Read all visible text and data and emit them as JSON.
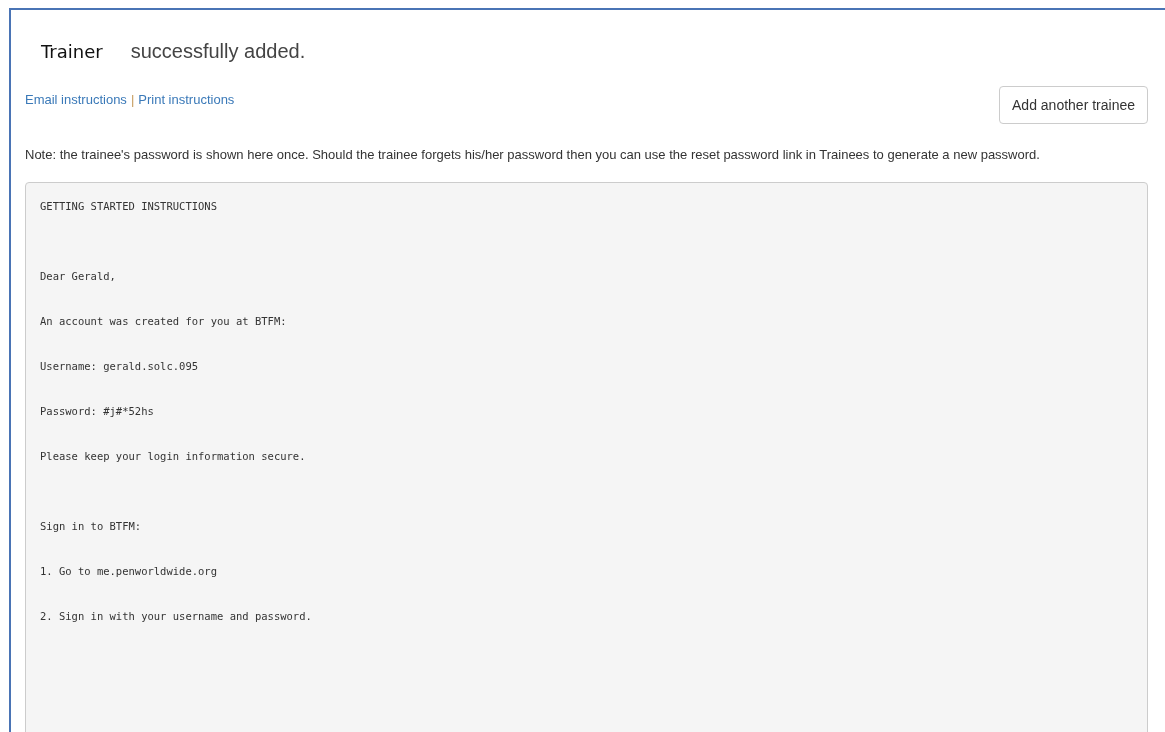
{
  "message": {
    "name": "Trainer",
    "text": "successfully added."
  },
  "links": [
    "Email instructions",
    "Print instructions"
  ],
  "link_separator": "|",
  "button": "Add another trainee",
  "note": "Note: the trainee's password is shown here once. Should the trainee forgets his/her password then you can use the reset password link in Trainees to generate a new password.",
  "instructions": [
    [
      "GETTING STARTED INSTRUCTIONS"
    ],
    [
      "Dear Gerald,",
      "An account was created for you at BTFM:",
      "Username: gerald.solc.095",
      "Password: #j#*52hs",
      "Please keep your login information secure."
    ],
    [
      "Sign in to BTFM:",
      "1. Go to me.penworldwide.org",
      "2. Sign in with your username and password."
    ]
  ]
}
